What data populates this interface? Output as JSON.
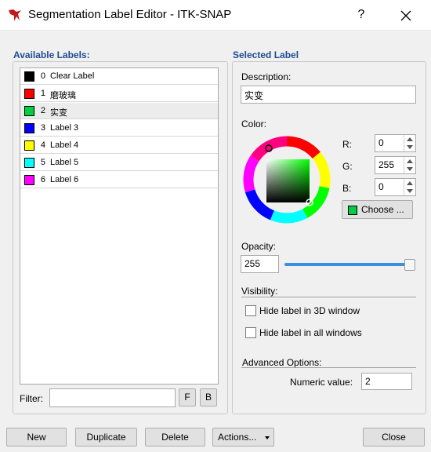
{
  "window": {
    "title": "Segmentation Label Editor - ITK-SNAP",
    "help_label": "?"
  },
  "available_labels": {
    "heading": "Available Labels:",
    "items": [
      {
        "index": "0",
        "name": "Clear Label",
        "color": "#000000"
      },
      {
        "index": "1",
        "name": "磨玻璃",
        "color": "#ff0000"
      },
      {
        "index": "2",
        "name": "实变",
        "color": "#00cc44",
        "selected": true
      },
      {
        "index": "3",
        "name": "Label 3",
        "color": "#0000ff"
      },
      {
        "index": "4",
        "name": "Label 4",
        "color": "#ffff00"
      },
      {
        "index": "5",
        "name": "Label 5",
        "color": "#00ffff"
      },
      {
        "index": "6",
        "name": "Label 6",
        "color": "#ff00ff"
      }
    ],
    "filter_label": "Filter:",
    "filter_value": "",
    "f_button": "F",
    "b_button": "B"
  },
  "selected_label": {
    "heading": "Selected Label",
    "description_label": "Description:",
    "description_value": "实变",
    "color_label": "Color:",
    "r_label": "R:",
    "r_value": "0",
    "g_label": "G:",
    "g_value": "255",
    "b_label": "B:",
    "b_value": "0",
    "choose_label": "Choose ...",
    "choose_swatch": "#00cc44",
    "opacity_label": "Opacity:",
    "opacity_value": "255",
    "opacity_fraction": 1.0,
    "visibility_label": "Visibility:",
    "hide_3d_label": "Hide label in 3D window",
    "hide_all_label": "Hide label in all windows",
    "advanced_label": "Advanced Options:",
    "numeric_label": "Numeric value:",
    "numeric_value": "2"
  },
  "buttons": {
    "new": "New",
    "duplicate": "Duplicate",
    "delete": "Delete",
    "actions": "Actions...",
    "close": "Close"
  }
}
